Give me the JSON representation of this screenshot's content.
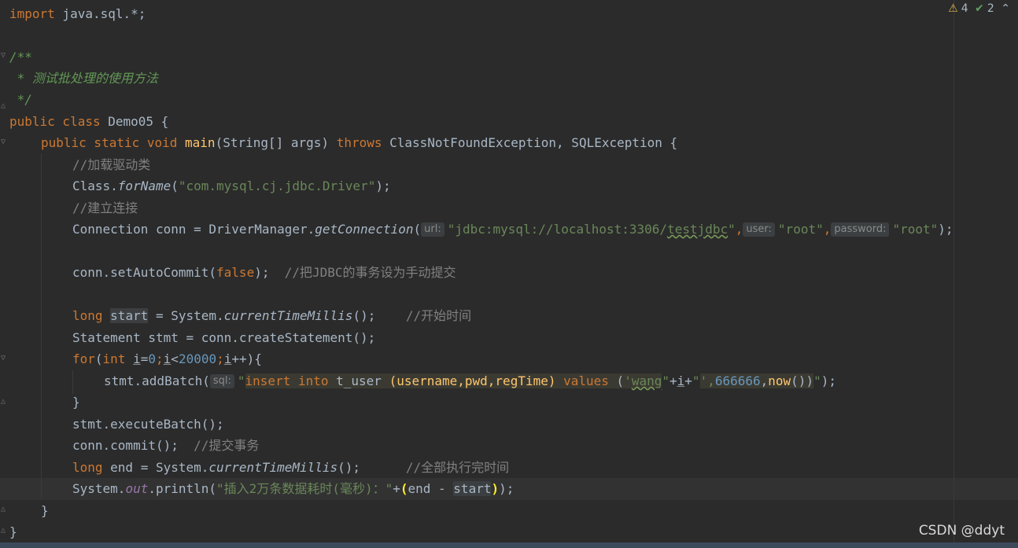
{
  "inspections": {
    "warnings": "4",
    "typos": "2",
    "warn_icon": "⚠",
    "ok_icon": "✔",
    "chevron": "⌃"
  },
  "code": {
    "l1": {
      "kw": "import",
      "rest": " java.sql.*;"
    },
    "l3": "/**",
    "l4": " * 测试批处理的使用方法",
    "l5": " */",
    "l6": {
      "kw": "public class",
      "rest": " Demo05 {"
    },
    "l7": {
      "kw1": "public static void",
      "fn": "main",
      "p1": "(String[] args) ",
      "kw2": "throws",
      "p2": " ClassNotFoundException, SQLException {"
    },
    "l8": "//加载驱动类",
    "l9": {
      "a": "Class.",
      "m": "forName",
      "b": "(",
      "s": "\"com.mysql.cj.jdbc.Driver\"",
      "c": ");"
    },
    "l10": "//建立连接",
    "l11": {
      "a": "Connection conn = DriverManager.",
      "m": "getConnection",
      "b": "(",
      "h1": "url:",
      "s1a": "\"jdbc:mysql://localhost:3306/",
      "s1b": "testjdbc",
      "s1c": "\"",
      "c1": ",",
      "h2": "user:",
      "s2": "\"root\"",
      "c2": ",",
      "h3": "password:",
      "s3": "\"root\"",
      "end": ");"
    },
    "l13": {
      "a": "conn.setAutoCommit(",
      "kw": "false",
      "b": ");",
      "cm": "  //把JDBC的事务设为手动提交"
    },
    "l15": {
      "kw": "long",
      "sp": " ",
      "v": "start",
      "a": " = System.",
      "m": "currentTimeMillis",
      "b": "();",
      "cm": "    //开始时间"
    },
    "l16": "Statement stmt = conn.createStatement();",
    "l17": {
      "kw1": "for",
      "a": "(",
      "kw2": "int",
      "sp": " ",
      "i1": "i",
      "eq": "=",
      "n1": "0",
      "sc1": ";",
      "i2": "i",
      "lt": "<",
      "n2": "20000",
      "sc2": ";",
      "i3": "i",
      "pp": "++){"
    },
    "l18": {
      "a": "stmt.addBatch(",
      "h": "sql:",
      "q1": "\"",
      "ins": "insert into",
      "sp1": " t_user ",
      "cols": "(username,pwd,regTime)",
      "sp2": " ",
      "vals": "values",
      "sp3": " (",
      "w1": "'",
      "w2": "wang",
      "q2": "\"",
      "plus": "+",
      "iv": "i",
      "plus2": "+",
      "q3": "\"",
      "tail1": "',",
      "n": "666666",
      "tail2": ",",
      "now": "now",
      "tail3": "())",
      "q4": "\"",
      "end": ");"
    },
    "l19": "}",
    "l20": "stmt.executeBatch();",
    "l21": {
      "a": "conn.commit();",
      "cm": "  //提交事务"
    },
    "l22": {
      "kw": "long",
      "a": " end = System.",
      "m": "currentTimeMillis",
      "b": "();",
      "cm": "      //全部执行完时间"
    },
    "l23": {
      "a": "System.",
      "f": "out",
      "b": ".println(",
      "s": "\"插入2万条数据耗时(毫秒)：\"",
      "plus": "+",
      "lp": "(",
      "e": "end - ",
      "st": "start",
      "rp": ")",
      "end": ");"
    },
    "l24": "}",
    "l25": "}"
  },
  "watermark": "CSDN @ddyt"
}
